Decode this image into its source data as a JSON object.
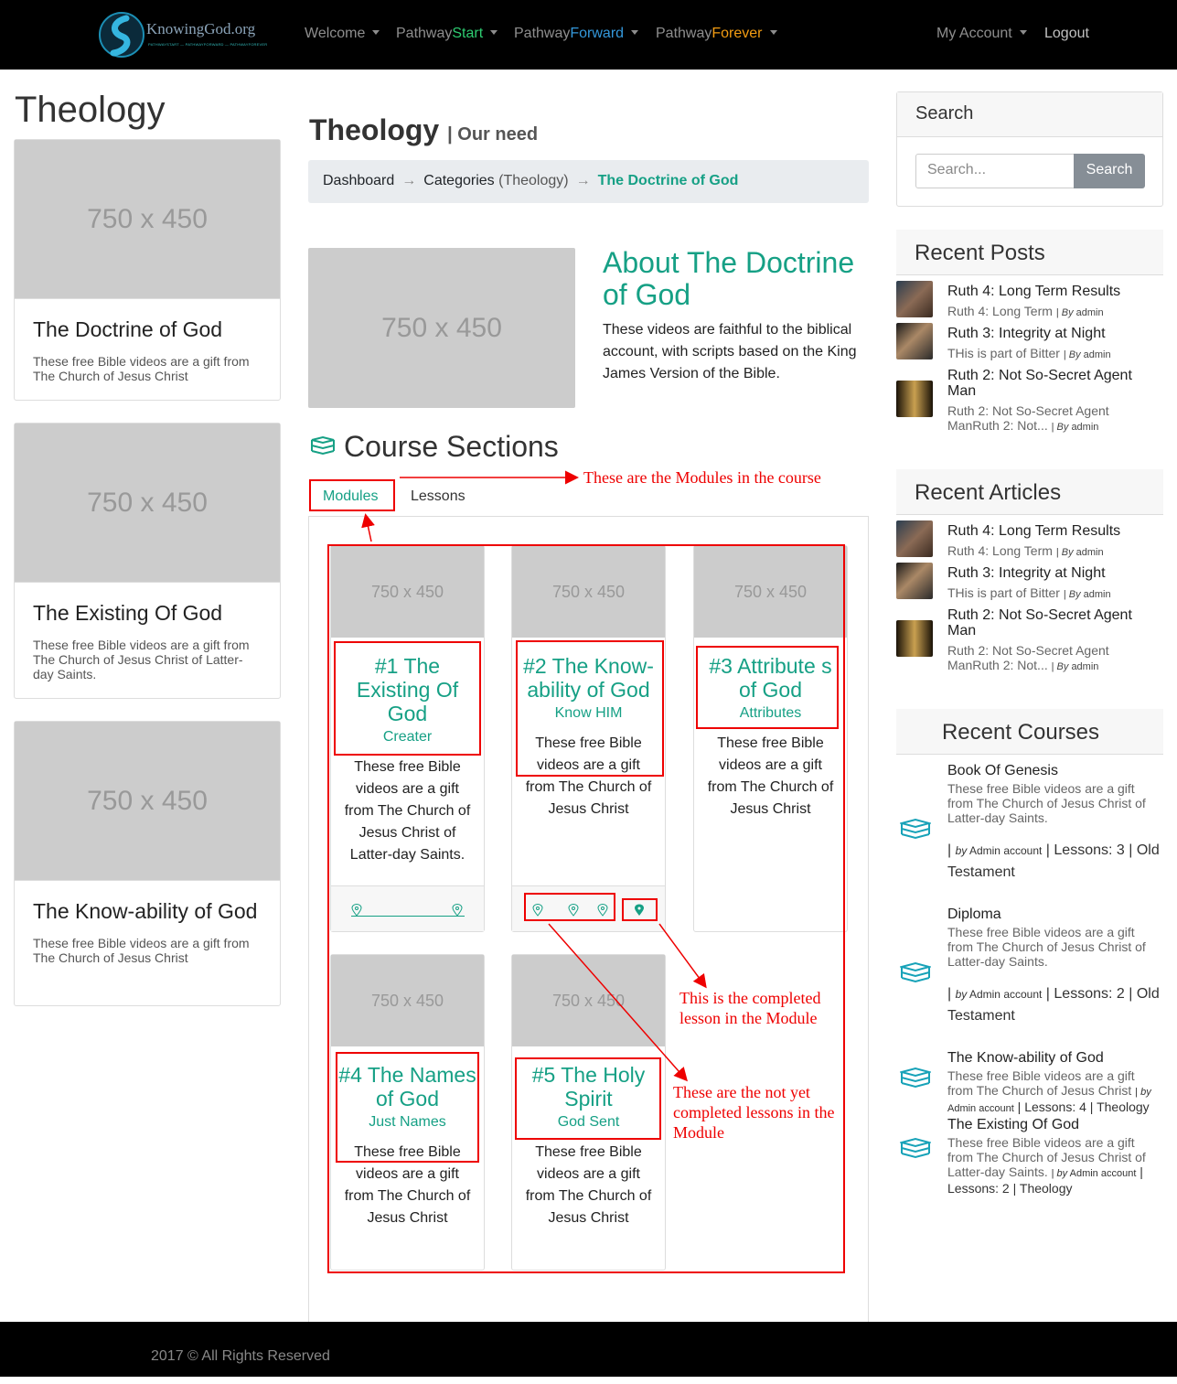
{
  "nav": {
    "logo_text": "KnowingGod.org",
    "logo_tagline": "PATHWAYSTART — PATHWAYFORWARD — PATHWAYFOREVER",
    "welcome": "Welcome",
    "path_start_prefix": "Pathway",
    "path_start_suffix": "Start",
    "path_forward_prefix": "Pathway",
    "path_forward_suffix": "Forward",
    "path_forever_prefix": "Pathway",
    "path_forever_suffix": "Forever",
    "my_account": "My Account",
    "logout": "Logout"
  },
  "left": {
    "title": "Theology",
    "cards": [
      {
        "image": "750 x 450",
        "title": "The Doctrine of God",
        "desc": "These free Bible videos are a gift from The Church of Jesus Christ"
      },
      {
        "image": "750 x 450",
        "title": "The Existing Of God",
        "desc": "These free Bible videos are a gift from The Church of Jesus Christ of Latter-day Saints."
      },
      {
        "image": "750 x 450",
        "title": "The Know-ability of God",
        "desc": "These free Bible videos are a gift from The Church of Jesus Christ"
      }
    ]
  },
  "main": {
    "heading": "Theology",
    "heading_small": "| Our need",
    "breadcrumb": {
      "dashboard": "Dashboard",
      "categories": "Categories",
      "categories_paren": "(Theology)",
      "arrow": "→",
      "current": "The Doctrine of God"
    },
    "about": {
      "image": "750 x 450",
      "title": "About The Doctrine of God",
      "text": "These videos are faithful to the biblical account, with scripts based on the King James Version of the Bible."
    },
    "course_sections_title": "Course Sections",
    "tabs": {
      "modules": "Modules",
      "lessons": "Lessons"
    },
    "modules": [
      {
        "image": "750 x 450",
        "title": "#1 The Existing Of God",
        "subtitle": "Creater",
        "desc": "These free Bible videos are a gift from The Church of Jesus Christ of Latter-day Saints."
      },
      {
        "image": "750 x 450",
        "title": "#2 The Know-ability of God",
        "subtitle": "Know HIM",
        "desc": "These free Bible videos are a gift from The Church of Jesus Christ"
      },
      {
        "image": "750 x 450",
        "title": "#3 Attribute s of God",
        "subtitle": "Attributes",
        "desc": "These free Bible videos are a gift from The Church of Jesus Christ"
      },
      {
        "image": "750 x 450",
        "title": "#4 The Names of God",
        "subtitle": "Just Names",
        "desc": "These free Bible videos are a gift from The Church of Jesus Christ"
      },
      {
        "image": "750 x 450",
        "title": "#5 The Holy Spirit",
        "subtitle": "God Sent",
        "desc": "These free Bible videos are a gift from The Church of Jesus Christ"
      }
    ],
    "annotations": {
      "modules_note": "These are the Modules in the course",
      "completed_note": "This is the completed lesson in the Module",
      "not_completed_note": "These are the not yet completed lessons in the Module"
    }
  },
  "sidebar": {
    "search": {
      "title": "Search",
      "placeholder": "Search...",
      "button": "Search"
    },
    "recent_posts": {
      "title": "Recent Posts",
      "items": [
        {
          "title": "Ruth 4: Long Term Results",
          "excerpt": "Ruth 4: Long Term",
          "by": "By",
          "author": "admin"
        },
        {
          "title": "Ruth 3: Integrity at Night",
          "excerpt": "THis is part of Bitter",
          "by": "By",
          "author": "admin"
        },
        {
          "title": "Ruth 2: Not So-Secret Agent Man",
          "excerpt": "Ruth 2: Not So-Secret Agent ManRuth 2: Not...",
          "by": "By",
          "author": "admin"
        }
      ]
    },
    "recent_articles": {
      "title": "Recent Articles",
      "items": [
        {
          "title": "Ruth 4: Long Term Results",
          "excerpt": "Ruth 4: Long Term",
          "by": "By",
          "author": "admin"
        },
        {
          "title": "Ruth 3: Integrity at Night",
          "excerpt": "THis is part of Bitter",
          "by": "By",
          "author": "admin"
        },
        {
          "title": "Ruth 2: Not So-Secret Agent Man",
          "excerpt": "Ruth 2: Not So-Secret Agent ManRuth 2: Not...",
          "by": "By",
          "author": "admin"
        }
      ]
    },
    "recent_courses": {
      "title": "Recent Courses",
      "items": [
        {
          "title": "Book Of Genesis",
          "desc": "These free Bible videos are a gift from The Church of Jesus Christ of Latter-day Saints.",
          "by": "by",
          "author": "Admin account",
          "lessons": "Lessons: 3",
          "category": "Old Testament"
        },
        {
          "title": "Diploma",
          "desc": "These free Bible videos are a gift from The Church of Jesus Christ of Latter-day Saints.",
          "by": "by",
          "author": "Admin account",
          "lessons": "Lessons: 2",
          "category": "Old Testament"
        },
        {
          "title": "The Know-ability of God",
          "desc": "These free Bible videos are a gift from The Church of Jesus Christ",
          "by": "by",
          "author": "Admin account",
          "lessons": "Lessons: 4",
          "category": "Theology"
        },
        {
          "title": "The Existing Of God",
          "desc": "These free Bible videos are a gift from The Church of Jesus Christ of Latter-day Saints.",
          "by": "by",
          "author": "Admin account",
          "lessons": "Lessons: 2",
          "category": "Theology"
        }
      ]
    }
  },
  "footer": {
    "text": "2017 © All Rights Reserved"
  },
  "colors": {
    "accent": "#16a085",
    "annotation": "#e00000",
    "navbar": "#000000",
    "start": "#2ecc71",
    "forward": "#3498db",
    "forever": "#f39c12"
  }
}
